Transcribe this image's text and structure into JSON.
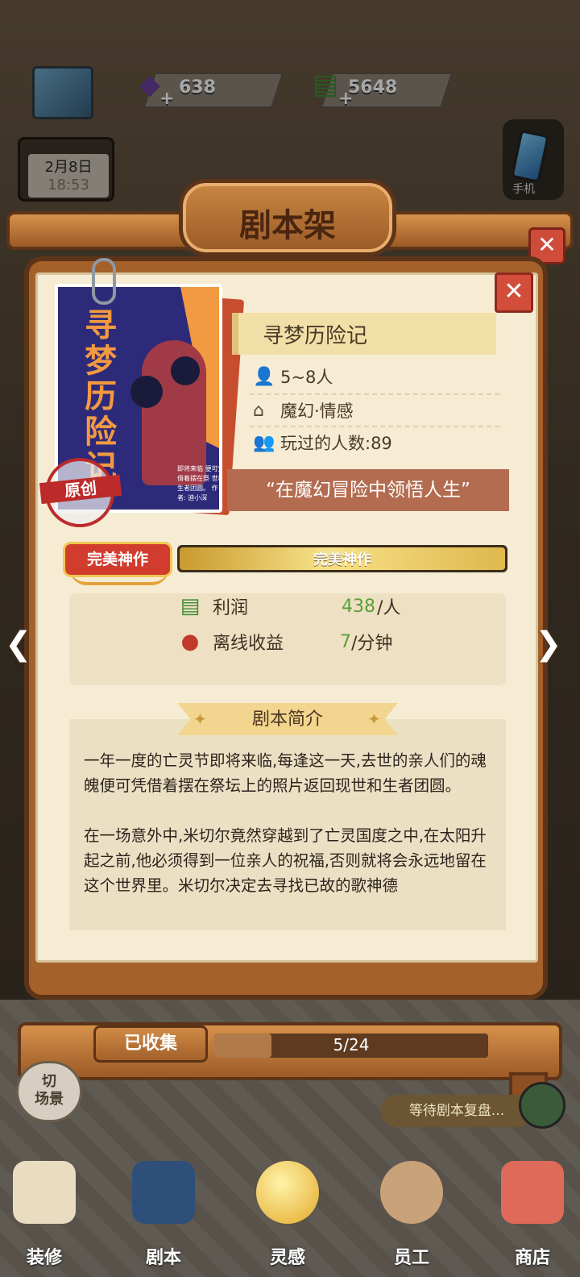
{
  "hud": {
    "gem_count": "638",
    "cash_count": "5648",
    "plus": "+",
    "date": "2月8日",
    "time": "18:53",
    "phone_label": "手机"
  },
  "shelf": {
    "title": "剧本架"
  },
  "script": {
    "poster_title": "寻梦历险记",
    "poster_small_text": "即将来临 便可凭借着摆在祭 世和生者团圆。 作者: 迪小深",
    "stamp": "原创",
    "name": "寻梦历险记",
    "players": "5~8人",
    "tags": "魔幻·情感",
    "played_count": "玩过的人数:89",
    "slogan": "“在魔幻冒险中领悟人生”"
  },
  "rating": {
    "badge": "完美神作",
    "bar_text": "完美神作",
    "level": 1.0
  },
  "stats": {
    "profit_label": "利润",
    "profit_value": "438",
    "profit_unit": "/人",
    "offline_label": "离线收益",
    "offline_value": "7",
    "offline_unit": "/分钟"
  },
  "intro": {
    "title": "剧本简介",
    "paragraph1": "一年一度的亡灵节即将来临,每逢这一天,去世的亲人们的魂魄便可凭借着摆在祭坛上的照片返回现世和生者团圆。",
    "paragraph2": "在一场意外中,米切尔竟然穿越到了亡灵国度之中,在太阳升起之前,他必须得到一位亲人的祝福,否则就将会永远地留在这个世界里。米切尔决定去寻找已故的歌神德"
  },
  "collection": {
    "label": "已收集",
    "progress_text": "5/24",
    "collected": 5,
    "total": 24
  },
  "bottom": {
    "switch_scene": "切\n场景",
    "waiting": "等待剧本复盘...",
    "nav": [
      "装修",
      "剧本",
      "灵感",
      "员工",
      "商店"
    ]
  },
  "colors": {
    "accent_red": "#d24d3a",
    "profit_green": "#5aa038",
    "wood": "#a4612a",
    "paper": "#f6ecd4"
  }
}
